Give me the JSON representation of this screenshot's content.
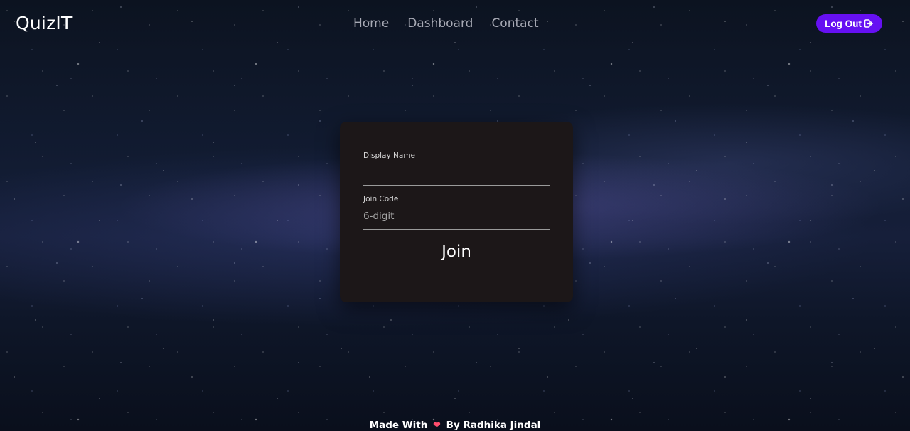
{
  "navbar": {
    "brand": "QuizIT",
    "links": [
      {
        "label": "Home"
      },
      {
        "label": "Dashboard"
      },
      {
        "label": "Contact"
      }
    ],
    "logout_label": "Log Out"
  },
  "join_form": {
    "display_name_label": "Display Name",
    "display_name_value": "",
    "join_code_label": "Join Code",
    "join_code_placeholder": "6-digit",
    "join_button_label": "Join"
  },
  "footer": {
    "prefix": "Made With",
    "suffix": "By Radhika Jindal",
    "heart_icon": "heart-icon"
  },
  "colors": {
    "accent": "#6610f2",
    "card_background": "#1c1718",
    "heart": "#ff4d6d"
  }
}
